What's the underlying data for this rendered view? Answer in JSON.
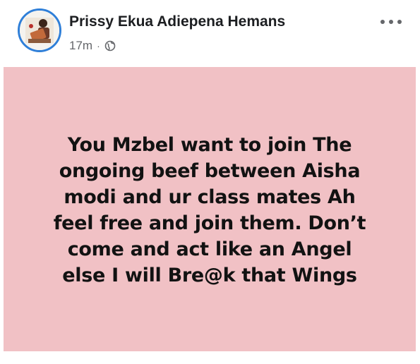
{
  "post": {
    "author": "Prissy Ekua Adiepena Hemans",
    "time": "17m",
    "separator": "·",
    "audience_icon": "globe-icon",
    "more_icon": "more-options-icon",
    "background_color": "#f1c1c5",
    "text_lines": [
      "You Mzbel want to join The",
      "ongoing beef between Aisha",
      "modi and ur class mates Ah",
      "feel free and join them. Don’t",
      "come and act like an Angel",
      "else I will Bre@k that Wings"
    ]
  }
}
